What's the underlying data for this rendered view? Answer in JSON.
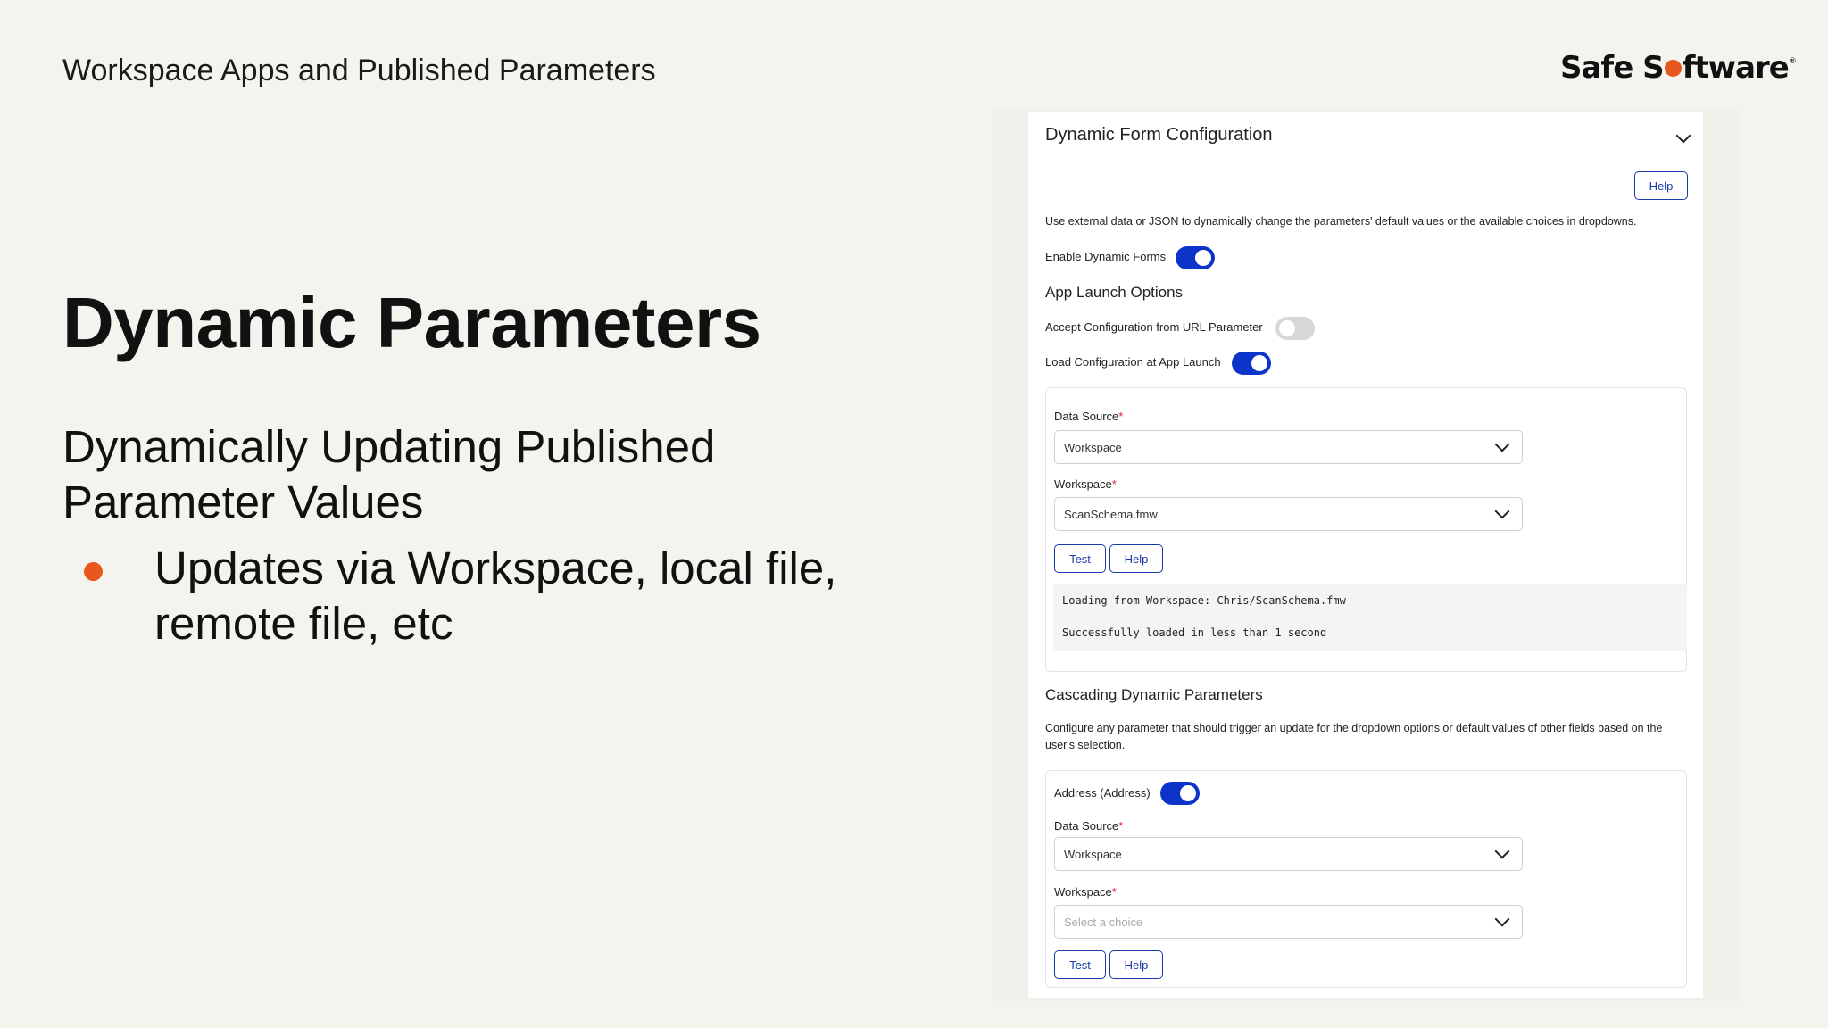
{
  "slide": {
    "header": "Workspace Apps and Published Parameters",
    "logo_text_before": "Safe S",
    "logo_text_after": "ftware",
    "logo_mark": "®",
    "title": "Dynamic Parameters",
    "subtitle": "Dynamically Updating Published Parameter Values",
    "bullets": [
      "Updates via Workspace, local file, remote file, etc"
    ]
  },
  "panel": {
    "title": "Dynamic Form Configuration",
    "help_label": "Help",
    "description": "Use external data or JSON to dynamically change the parameters' default values or the available choices in dropdowns.",
    "enable_label": "Enable Dynamic Forms",
    "enable_on": true,
    "app_launch": {
      "heading": "App Launch Options",
      "url_param_label": "Accept Configuration from URL Parameter",
      "url_param_on": false,
      "load_label": "Load Configuration at App Launch",
      "load_on": true
    },
    "config": {
      "data_source_label": "Data Source",
      "data_source_value": "Workspace",
      "workspace_label": "Workspace",
      "workspace_value": "ScanSchema.fmw",
      "test_label": "Test",
      "help_label": "Help",
      "log_lines": [
        "Loading from Workspace: Chris/ScanSchema.fmw",
        "Successfully loaded in less than 1 second"
      ]
    },
    "cascading": {
      "heading": "Cascading Dynamic Parameters",
      "description_line1": "Configure any parameter that should trigger an update for the dropdown options or default values of other fields based on the",
      "description_line2": "user's selection.",
      "address_label": "Address (Address)",
      "address_on": true,
      "data_source_label": "Data Source",
      "data_source_value": "Workspace",
      "workspace_label": "Workspace",
      "workspace_placeholder": "Select a choice",
      "test_label": "Test",
      "help_label": "Help"
    },
    "required_mark": "*"
  },
  "colors": {
    "accent_orange": "#e8571e",
    "toggle_blue": "#0d34c8",
    "button_blue": "#1a3aa8",
    "background": "#f4f3ee"
  },
  "icons": [
    "chevron-down-icon"
  ]
}
